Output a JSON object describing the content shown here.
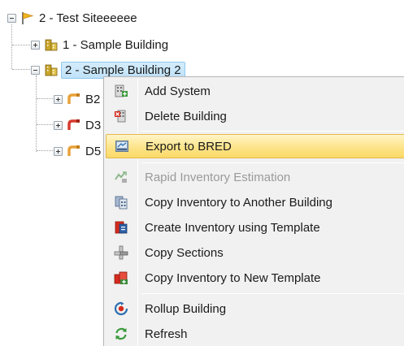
{
  "tree": {
    "root": {
      "label": "2 - Test Siteeeeee",
      "icon": "flag-icon"
    },
    "buildings": [
      {
        "label": "1 - Sample Building",
        "icon": "building-icon",
        "expanded": false,
        "selected": false
      },
      {
        "label": "2 - Sample Building 2",
        "icon": "building-icon",
        "expanded": true,
        "selected": true
      }
    ],
    "systems": [
      {
        "label": "B2",
        "icon": "pipe-system-icon",
        "color": "#e8a23a"
      },
      {
        "label": "D3",
        "icon": "pipe-system-icon",
        "color": "#d63b2e"
      },
      {
        "label": "D5",
        "icon": "pipe-system-icon",
        "color": "#e8a23a"
      }
    ]
  },
  "context_menu": {
    "items": [
      {
        "label": "Add System",
        "icon": "add-system-icon",
        "enabled": true,
        "highlighted": false
      },
      {
        "label": "Delete Building",
        "icon": "delete-building-icon",
        "enabled": true,
        "highlighted": false
      },
      {
        "label": "Export to BRED",
        "icon": "export-icon",
        "enabled": true,
        "highlighted": true
      },
      {
        "label": "Rapid Inventory Estimation",
        "icon": "rapid-estimation-icon",
        "enabled": false,
        "highlighted": false
      },
      {
        "label": "Copy Inventory to Another Building",
        "icon": "copy-inventory-icon",
        "enabled": true,
        "highlighted": false
      },
      {
        "label": "Create Inventory using Template",
        "icon": "template-icon",
        "enabled": true,
        "highlighted": false
      },
      {
        "label": "Copy Sections",
        "icon": "copy-sections-icon",
        "enabled": true,
        "highlighted": false
      },
      {
        "label": "Copy Inventory to New Template",
        "icon": "new-template-icon",
        "enabled": true,
        "highlighted": false
      },
      {
        "label": "Rollup Building",
        "icon": "rollup-icon",
        "enabled": true,
        "highlighted": false
      },
      {
        "label": "Refresh",
        "icon": "refresh-icon",
        "enabled": true,
        "highlighted": false
      }
    ]
  },
  "colors": {
    "selection": "#bfe2f8",
    "menu_highlight": "#fde48a",
    "building": "#c9a52a",
    "flag": "#f0b323"
  }
}
